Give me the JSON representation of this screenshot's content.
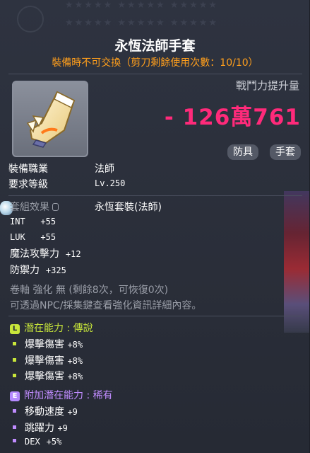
{
  "header": {
    "stars_row1": "★★★★★  ★★★★★  ★★★★★",
    "stars_row2": "★★★★★  ★★★★★  ★★★★★"
  },
  "item": {
    "name": "永恆法師手套",
    "trade_note": "裝備時不可交換（剪刀剩餘使用次數：10/10）",
    "power_label": "戰鬥力提升量",
    "power_value": "- 126萬761",
    "tags": [
      "防具",
      "手套"
    ]
  },
  "requirements": [
    {
      "label": "裝備職業",
      "value": "法師"
    },
    {
      "label": "要求等級",
      "value": "Lv.250"
    }
  ],
  "set_effect": {
    "label": "套組效果",
    "value": "永恆套裝(法師)"
  },
  "stats": [
    {
      "label": "INT",
      "value": "+55"
    },
    {
      "label": "LUK",
      "value": "+55"
    },
    {
      "label": "魔法攻擊力",
      "value": "+12"
    },
    {
      "label": "防禦力",
      "value": "+325"
    }
  ],
  "scroll_line": "卷軸 強化 無 (剩餘8次，可恢復0次)",
  "info_line": "可透過NPC/採集鍵查看強化資訊詳細內容。",
  "potential": {
    "badge": "L",
    "title": "潛在能力 : 傳說",
    "lines": [
      {
        "label": "爆擊傷害",
        "value": "+8%"
      },
      {
        "label": "爆擊傷害",
        "value": "+8%"
      },
      {
        "label": "爆擊傷害",
        "value": "+8%"
      }
    ]
  },
  "additional": {
    "badge": "E",
    "title": "附加潛在能力 : 稀有",
    "lines": [
      {
        "label": "移動速度",
        "value": "+9"
      },
      {
        "label": "跳躍力",
        "value": "+9"
      },
      {
        "label": "DEX",
        "value": "+5%"
      }
    ]
  },
  "colors": {
    "power": "#ff2a7a",
    "trade": "#ff9f1c",
    "legendary": "#c8e63a",
    "rare": "#c08cff"
  }
}
